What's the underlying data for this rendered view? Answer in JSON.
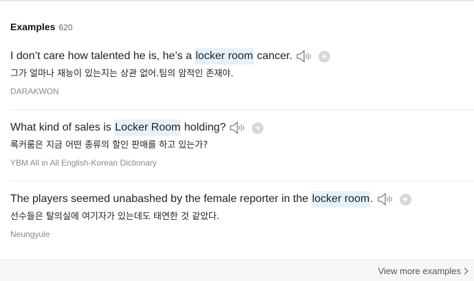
{
  "header": {
    "title": "Examples",
    "count": "620"
  },
  "examples": [
    {
      "pre": "I don’t care how talented he is, he’s a ",
      "highlight": "locker room",
      "post": " cancer.",
      "translation": "그가 얼마나 재능이 있는지는 상관 없어.팀의 암적인 존재야.",
      "source": "DARAKWON"
    },
    {
      "pre": "What kind of sales is ",
      "highlight": "Locker Room",
      "post": " holding?",
      "translation": "록커룸은 지금 어떤 종류의 할인 판매를 하고 있는가?",
      "source": "YBM All in All English-Korean Dictionary"
    },
    {
      "pre": "The players seemed unabashed by the female reporter in the ",
      "highlight": "locker room",
      "post": ".",
      "translation": "선수들은 탈의실에 여기자가 있는데도 태연한 것 같았다.",
      "source": "Neungyule"
    }
  ],
  "add_symbol": "+",
  "footer": {
    "view_more": "View more examples"
  },
  "icons": {
    "speaker": "speaker-icon",
    "add": "plus-circle-icon",
    "chevron": "chevron-right-icon"
  },
  "colors": {
    "highlight_bg": "#e5f2fc",
    "source_text": "#8a8a8a",
    "footer_bg": "#f7f7f7"
  }
}
